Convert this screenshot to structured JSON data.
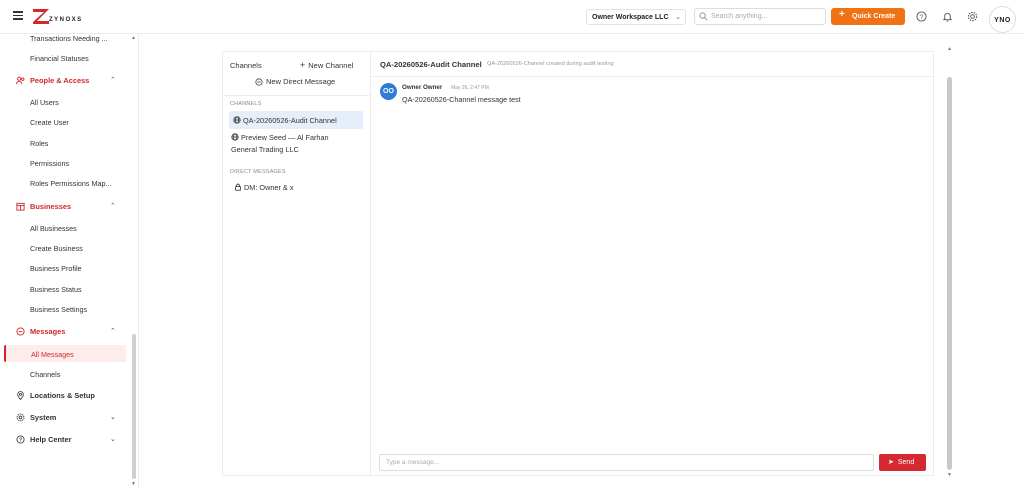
{
  "header": {
    "logo_text": "ZYNOXS",
    "workspace": "Owner Workspace LLC",
    "search_placeholder": "Search anything...",
    "quick_create": "Quick Create",
    "avatar_text": "YNO",
    "accent": "#f07214",
    "brand_red": "#d0282d"
  },
  "sidebar": {
    "items": {
      "transactions": "Transactions Needing ...",
      "financial": "Financial Statuses",
      "people_access": "People & Access",
      "all_users": "All Users",
      "create_user": "Create User",
      "roles": "Roles",
      "permissions": "Permissions",
      "roles_map": "Roles Permissions Map...",
      "businesses": "Businesses",
      "all_businesses": "All Businesses",
      "create_business": "Create Business",
      "business_profile": "Business Profile",
      "business_status": "Business Status",
      "business_settings": "Business Settings",
      "messages": "Messages",
      "all_messages": "All Messages",
      "channels": "Channels",
      "locations": "Locations & Setup",
      "system": "System",
      "help": "Help Center"
    }
  },
  "channels_panel": {
    "title": "Channels",
    "new_channel": "New Channel",
    "new_dm": "New Direct Message",
    "channels_label": "CHANNELS",
    "channels": [
      "QA-20260526-Audit Channel",
      "Preview Seed — Al Farhan",
      "General Trading LLC"
    ],
    "dm_label": "DIRECT MESSAGES",
    "dms": [
      "DM: Owner & x"
    ]
  },
  "chat": {
    "name": "QA-20260526-Audit Channel",
    "description": "QA-20260526-Channel created during audit testing",
    "messages": [
      {
        "avatar": "OO",
        "author": "Owner Owner",
        "time": "May 26, 2:47 PM",
        "text": "QA-20260526-Channel message test"
      }
    ],
    "composer_placeholder": "Type a message...",
    "send_label": "Send",
    "avatar_color": "#2f7cd3",
    "send_color": "#d42a2f"
  }
}
